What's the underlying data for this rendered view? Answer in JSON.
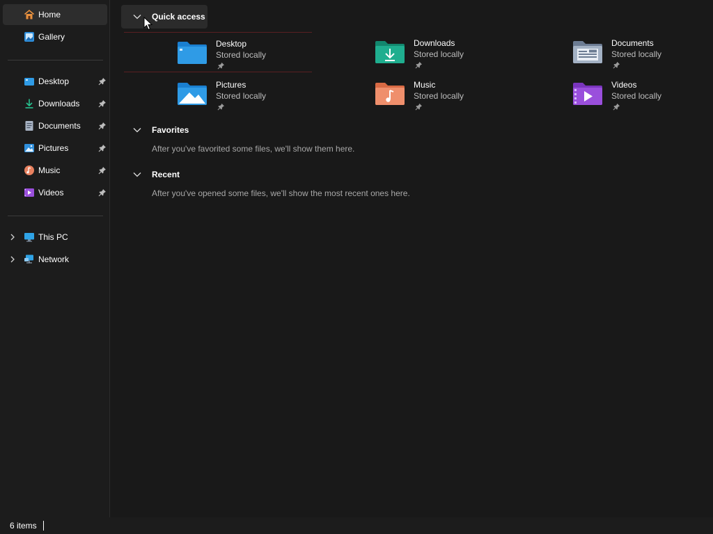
{
  "sidebar": {
    "top_items": [
      {
        "label": "Home",
        "icon": "home-icon"
      },
      {
        "label": "Gallery",
        "icon": "gallery-icon"
      }
    ],
    "pinned_items": [
      {
        "label": "Desktop",
        "icon": "desktop-folder-icon"
      },
      {
        "label": "Downloads",
        "icon": "downloads-icon"
      },
      {
        "label": "Documents",
        "icon": "documents-icon"
      },
      {
        "label": "Pictures",
        "icon": "pictures-icon"
      },
      {
        "label": "Music",
        "icon": "music-icon"
      },
      {
        "label": "Videos",
        "icon": "videos-icon"
      }
    ],
    "drive_items": [
      {
        "label": "This PC",
        "icon": "this-pc-icon"
      },
      {
        "label": "Network",
        "icon": "network-icon"
      }
    ]
  },
  "main": {
    "quick_access": {
      "title": "Quick access",
      "items": [
        {
          "name": "Desktop",
          "subtitle": "Stored locally",
          "icon": "desktop-folder-icon"
        },
        {
          "name": "Downloads",
          "subtitle": "Stored locally",
          "icon": "downloads-folder-icon"
        },
        {
          "name": "Documents",
          "subtitle": "Stored locally",
          "icon": "documents-folder-icon"
        },
        {
          "name": "Pictures",
          "subtitle": "Stored locally",
          "icon": "pictures-folder-icon"
        },
        {
          "name": "Music",
          "subtitle": "Stored locally",
          "icon": "music-folder-icon"
        },
        {
          "name": "Videos",
          "subtitle": "Stored locally",
          "icon": "videos-folder-icon"
        }
      ]
    },
    "favorites": {
      "title": "Favorites",
      "empty_message": "After you've favorited some files, we'll show them here."
    },
    "recent": {
      "title": "Recent",
      "empty_message": "After you've opened some files, we'll show the most recent ones here."
    }
  },
  "status_bar": {
    "item_count": "6 items"
  },
  "colors": {
    "background": "#191919",
    "sidebar": "#1c1c1c",
    "selected": "#2d2d2d",
    "desktop_folder": "#2f9be6",
    "downloads_folder": "#1fae8f",
    "documents_folder": "#8a9bb4",
    "music_folder": "#e8815f",
    "videos_folder": "#9a4fdc"
  }
}
